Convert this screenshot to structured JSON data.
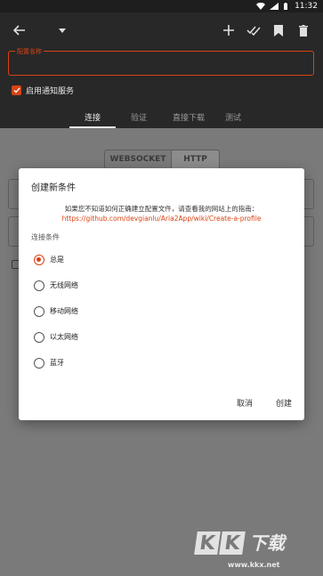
{
  "status_bar": {
    "time": "11:32"
  },
  "toolbar": {
    "icons": [
      "back-arrow-icon",
      "dropdown-caret-icon",
      "add-icon",
      "done-all-icon",
      "bookmark-icon",
      "delete-icon"
    ]
  },
  "config": {
    "field_label": "配置名称",
    "value": ""
  },
  "notify": {
    "label": "启用通知服务",
    "checked": true
  },
  "tabs": [
    {
      "label": "连接",
      "active": true
    },
    {
      "label": "验证",
      "active": false
    },
    {
      "label": "直接下载",
      "active": false
    },
    {
      "label": "测试",
      "active": false
    }
  ],
  "segmented": {
    "options": [
      "WEBSOCKET",
      "HTTP"
    ],
    "selected": "HTTP"
  },
  "dialog": {
    "title": "创建新条件",
    "message": "如果您不知道如何正确建立配置文件，请查看我的网站上的指南：",
    "link": "https://github.com/devgianlu/Aria2App/wiki/Create-a-profile",
    "section_label": "连接条件",
    "options": [
      {
        "label": "总是",
        "selected": true
      },
      {
        "label": "无线网络",
        "selected": false
      },
      {
        "label": "移动网络",
        "selected": false
      },
      {
        "label": "以太网络",
        "selected": false
      },
      {
        "label": "蓝牙",
        "selected": false
      }
    ],
    "cancel_label": "取消",
    "create_label": "创建"
  },
  "watermark": {
    "text": "KK下载",
    "url": "www.kkx.net"
  },
  "colors": {
    "accent": "#d84315",
    "dark_bar": "#282828",
    "scrim": "#7a7a7a"
  }
}
